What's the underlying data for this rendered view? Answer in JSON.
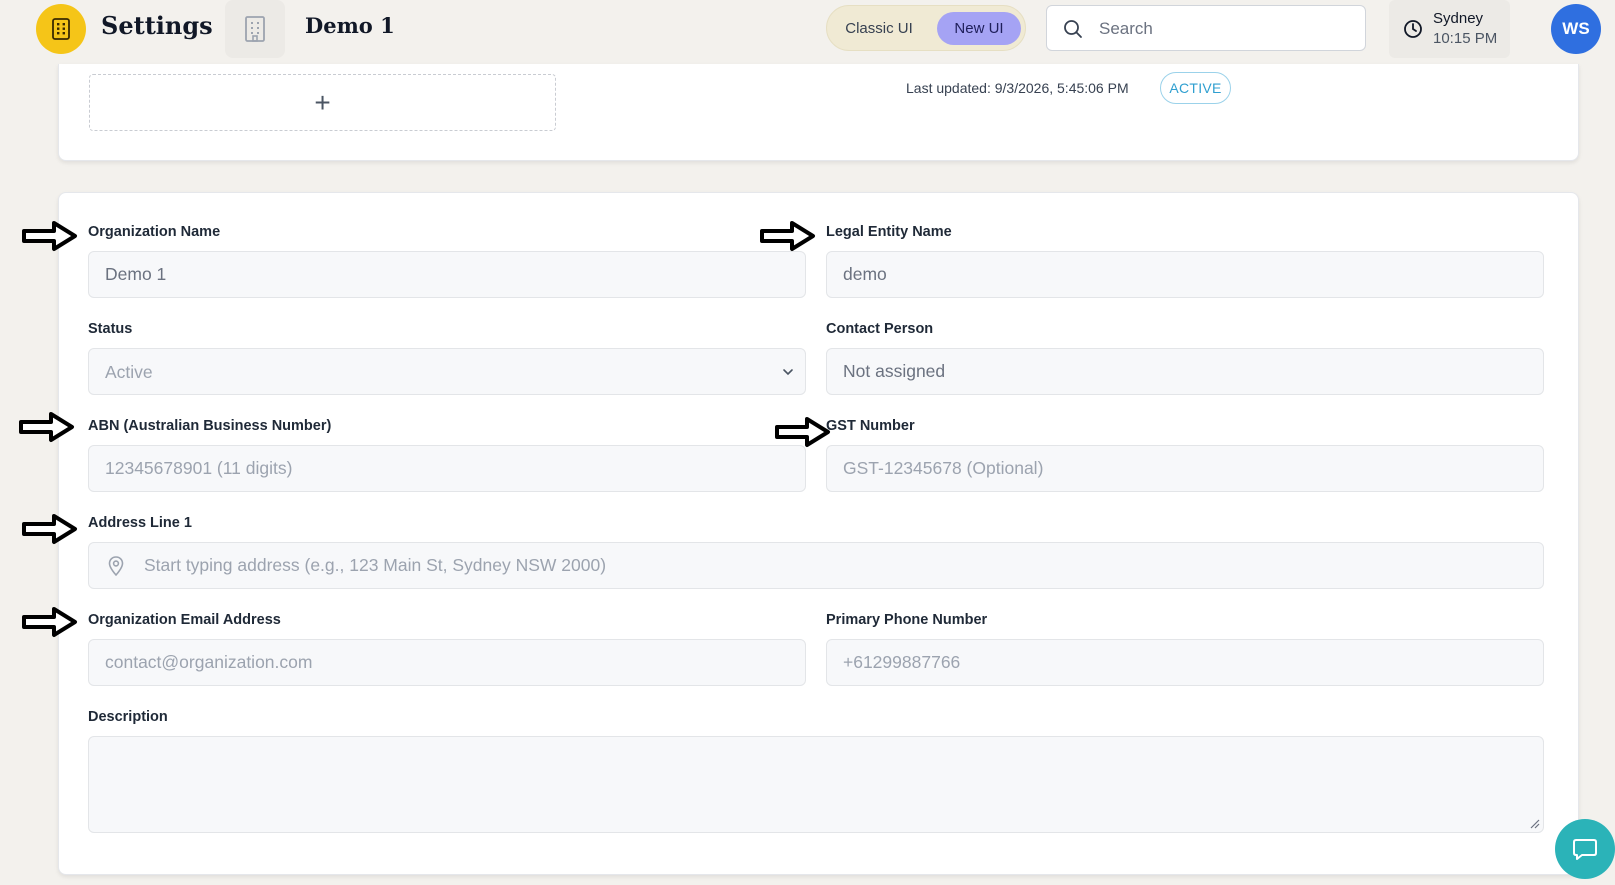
{
  "header": {
    "app_title": "Settings",
    "org_title": "Demo 1",
    "ui_toggle": {
      "classic_label": "Classic UI",
      "new_label": "New UI",
      "selected": "New UI"
    },
    "search": {
      "placeholder": "Search",
      "value": ""
    },
    "clock": {
      "city": "Sydney",
      "time": "10:15 PM"
    },
    "avatar_initials": "WS",
    "colors": {
      "logo": "#f5c518",
      "avatar": "#2f6fe0",
      "toggle_active": "#a5a3f4"
    }
  },
  "summary_card": {
    "add_symbol": "+",
    "last_updated": "Last updated: 9/3/2026, 5:45:06 PM",
    "status_badge": "ACTIVE"
  },
  "form": {
    "organization_name": {
      "label": "Organization Name",
      "value": "Demo 1",
      "placeholder": ""
    },
    "legal_entity_name": {
      "label": "Legal Entity Name",
      "value": "demo",
      "placeholder": ""
    },
    "status": {
      "label": "Status",
      "value": "Active"
    },
    "contact_person": {
      "label": "Contact Person",
      "value": "Not assigned"
    },
    "abn": {
      "label": "ABN (Australian Business Number)",
      "placeholder": "12345678901 (11 digits)"
    },
    "gst_number": {
      "label": "GST Number",
      "placeholder": "GST-12345678 (Optional)"
    },
    "address_line_1": {
      "label": "Address Line 1",
      "placeholder": "Start typing address (e.g., 123 Main St, Sydney NSW 2000)"
    },
    "email": {
      "label": "Organization Email Address",
      "placeholder": "contact@organization.com"
    },
    "phone": {
      "label": "Primary Phone Number",
      "placeholder": "+61299887766"
    },
    "description": {
      "label": "Description",
      "value": ""
    }
  },
  "icons": {
    "logo": "building-icon",
    "org": "building-outline-icon",
    "search": "search-icon",
    "clock": "clock-icon",
    "address": "map-pin-icon",
    "select": "chevron-down-icon",
    "chat": "chat-bubble-icon",
    "annotation": "arrow-right-icon"
  }
}
